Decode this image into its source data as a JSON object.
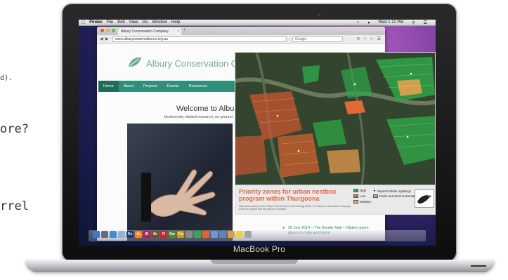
{
  "slide": {
    "fragment_1": "d).",
    "fragment_2": "ore?",
    "fragment_3": "rrel"
  },
  "laptop": {
    "brand_label": "MacBook Pro"
  },
  "menubar": {
    "apple_icon": "apple-icon",
    "items": [
      "Finder",
      "File",
      "Edit",
      "View",
      "Go",
      "Window",
      "Help"
    ],
    "clock": "Wed 1:11 PM",
    "status_icons": [
      "wifi-icon",
      "volume-icon",
      "search-icon",
      "list-icon"
    ]
  },
  "browser": {
    "tab_title": "Albury Conservation Company",
    "new_tab": "+",
    "url": "www.alburyconservationco.org.au",
    "search_placeholder": "Google",
    "toolbar_icons": [
      "back-icon",
      "forward-icon",
      "reload-icon",
      "home-icon",
      "bookmark-icon",
      "menu-icon"
    ]
  },
  "site": {
    "name": "Albury Conservation Comp",
    "nav": [
      "Home",
      "About",
      "Projects",
      "Events",
      "Resources"
    ],
    "welcome": "Welcome to Albury",
    "subline": "biodiversity related research, on-ground",
    "news_item": "30 July 2014 – The Border Mail – Gliders given places to hide and thrive"
  },
  "map": {
    "title": "Priority zones for urban nestbox program within Thurgoona",
    "note": "Data and courtesy of the Office of Environment and Heritage NSW. The Albury Conservation Company does not warrant that the data are accurate.",
    "legend": [
      {
        "label": "High",
        "color": "#2fb44a"
      },
      {
        "label": "Low",
        "color": "#e06a35"
      },
      {
        "label": "Medium",
        "color": "#f0a050"
      },
      {
        "label": "Squirrel Glider sightings",
        "color": "#ffffff"
      },
      {
        "label": "Parks and Environmental Lands",
        "color": "#9ab89a"
      }
    ]
  },
  "dock": {
    "icons": [
      "finder-icon",
      "launchpad-icon",
      "safari-icon",
      "preview-icon",
      "photoshop-icon",
      "illustrator-icon",
      "indesign-icon",
      "bridge-icon",
      "flash-icon",
      "dreamweaver-icon",
      "fireworks-icon",
      "system-prefs-icon",
      "chrome-icon",
      "firefox-icon",
      "itunes-icon",
      "mail-icon",
      "photos-icon",
      "stickies-icon",
      "trash-icon"
    ]
  },
  "colors": {
    "nav_green": "#2f8f7a",
    "map_title_orange": "#e26a4a",
    "link_green": "#2b8a6e"
  }
}
